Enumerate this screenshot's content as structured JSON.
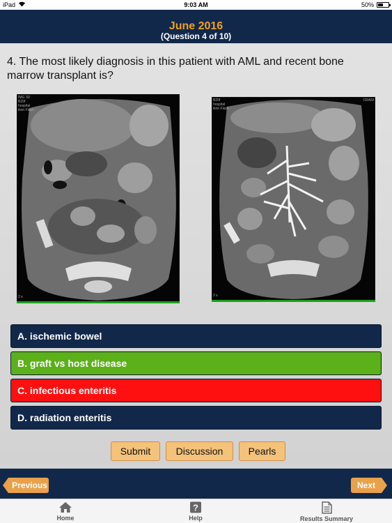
{
  "status_bar": {
    "carrier": "iPad",
    "time": "9:03 AM",
    "battery": "50%",
    "battery_level": 0.5
  },
  "header": {
    "title": "June 2016",
    "subtitle": "(Question 4 of 10)"
  },
  "question": {
    "text": "4. The most likely diagnosis in this patient with AML and recent bone marrow transplant is?"
  },
  "images": [
    {
      "label_top": "IMG 3D\nB20f\nhospital\nition Flash",
      "label_bottom": "2 s"
    },
    {
      "label_top": "B20f\nhospital\nition Flash",
      "label_right": "CRANI",
      "label_bottom": "2 s"
    }
  ],
  "answers": [
    {
      "label": "A. ischemic bowel",
      "color": "#12284a"
    },
    {
      "label": "B. graft vs host disease",
      "color": "#5cb01a"
    },
    {
      "label": "C. infectious enteritis",
      "color": "#ff1010"
    },
    {
      "label": "D. radiation enteritis",
      "color": "#12284a"
    }
  ],
  "actions": {
    "submit": "Submit",
    "discussion": "Discussion",
    "pearls": "Pearls"
  },
  "nav": {
    "previous": "Previous",
    "next": "Next"
  },
  "tabs": [
    {
      "label": "Home",
      "icon": "home-icon"
    },
    {
      "label": "Help",
      "icon": "help-icon"
    },
    {
      "label": "Results Summary",
      "icon": "results-icon"
    }
  ]
}
